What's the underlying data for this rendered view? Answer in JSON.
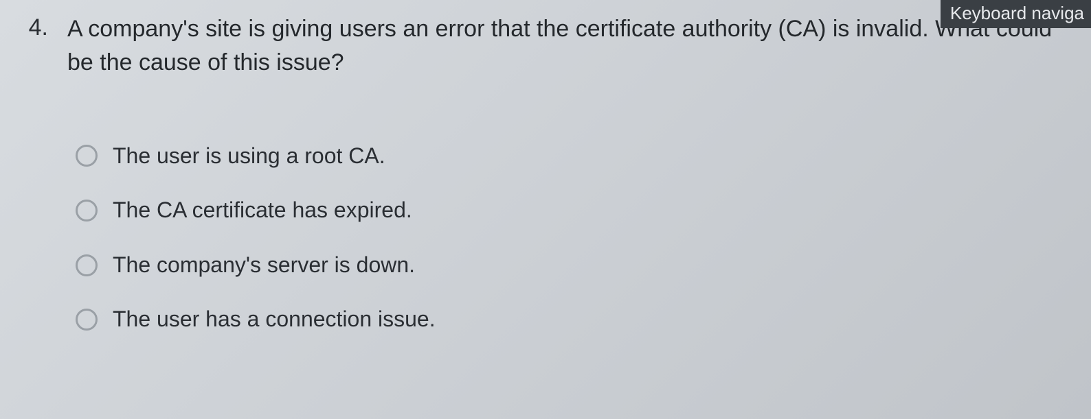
{
  "badge": "Keyboard naviga",
  "question": {
    "number": "4.",
    "text": "A company's site is giving users an error that the certificate authority (CA) is invalid. What could be the cause of this issue?"
  },
  "options": [
    {
      "label": "The user is using a root CA."
    },
    {
      "label": "The CA certificate has expired."
    },
    {
      "label": "The company's server is down."
    },
    {
      "label": "The user has a connection issue."
    }
  ]
}
